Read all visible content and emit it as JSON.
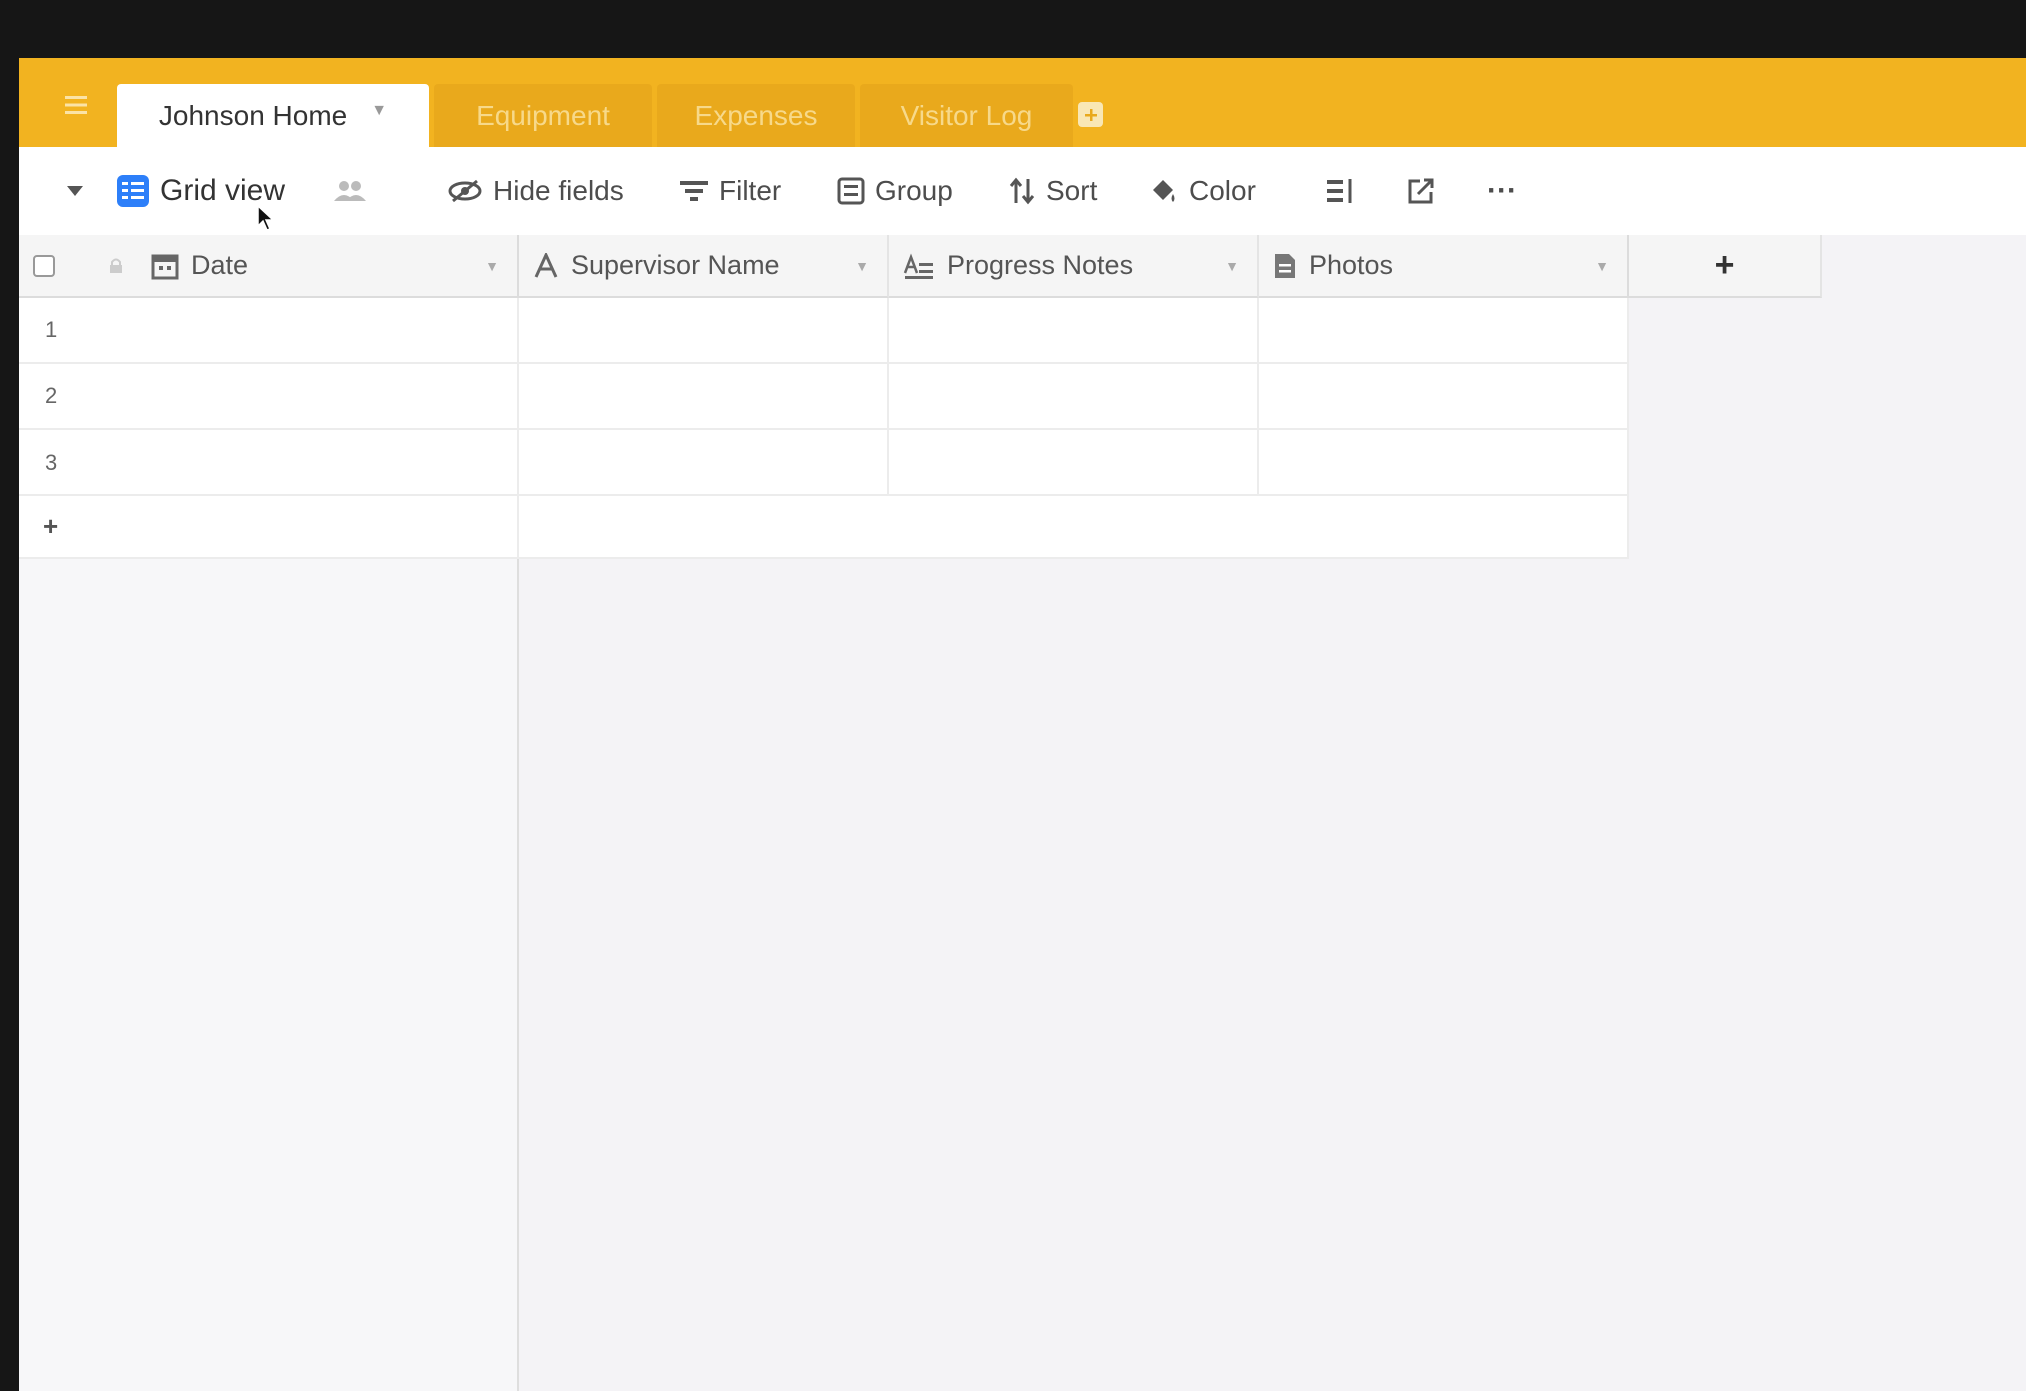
{
  "tabs": [
    {
      "label": "Johnson Home",
      "active": true
    },
    {
      "label": "Equipment",
      "active": false
    },
    {
      "label": "Expenses",
      "active": false
    },
    {
      "label": "Visitor Log",
      "active": false
    }
  ],
  "toolbar": {
    "view_name": "Grid view",
    "hide_fields": "Hide fields",
    "filter": "Filter",
    "group": "Group",
    "sort": "Sort",
    "color": "Color",
    "more": "···"
  },
  "columns": [
    {
      "name": "Date",
      "icon": "calendar-icon"
    },
    {
      "name": "Supervisor Name",
      "icon": "text-icon"
    },
    {
      "name": "Progress Notes",
      "icon": "long-text-icon"
    },
    {
      "name": "Photos",
      "icon": "attachment-icon"
    }
  ],
  "add_column_label": "+",
  "rows": [
    "1",
    "2",
    "3"
  ],
  "add_row_label": "+",
  "colors": {
    "tab_bar": "#f2b320",
    "inactive_tab": "#e9a91c",
    "inactive_tab_text": "#f7d98a",
    "grid_icon": "#2d7ff9"
  }
}
